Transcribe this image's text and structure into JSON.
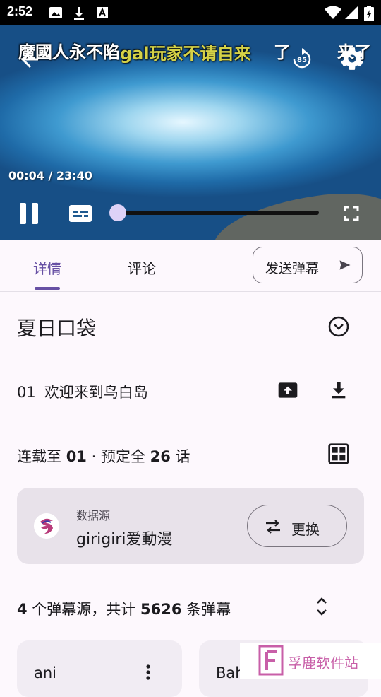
{
  "status_bar": {
    "time": "2:52",
    "icons": [
      "image-icon",
      "download-icon",
      "a-badge-icon",
      "wifi-icon",
      "signal-icon",
      "battery-icon"
    ]
  },
  "player": {
    "danmaku": [
      {
        "text": "魔國人永不陷",
        "color": "#ffffff"
      },
      {
        "text": "gal玩家不请自来",
        "color": "#d5d247"
      },
      {
        "text": "了",
        "color": "#ffffff"
      },
      {
        "text": "来了",
        "color": "#ffffff"
      }
    ],
    "replay_seconds": "85",
    "time_current": "00:04",
    "time_separator": " / ",
    "time_total": "23:40",
    "progress_fraction": 0.003
  },
  "tabs": {
    "details": "详情",
    "comments": "评论",
    "send_danmaku": "发送弹幕"
  },
  "anime": {
    "title": "夏日口袋",
    "episode_number": "01",
    "episode_title": "欢迎来到鸟白岛",
    "serial_prefix": "连载至 ",
    "serial_current": "01",
    "serial_middle": " · 预定全 ",
    "serial_total": "26",
    "serial_suffix": " 话"
  },
  "source": {
    "label": "数据源",
    "name": "girigiri爱動漫",
    "change_label": "更换"
  },
  "danmaku_info": {
    "source_count": "4",
    "text_a": " 个弹幕源，共计 ",
    "total": "5626",
    "text_b": " 条弹幕"
  },
  "danmaku_sources": [
    {
      "name": "ani"
    },
    {
      "name": "Bah"
    }
  ],
  "watermark": {
    "text": "孚鹿软件站"
  },
  "colors": {
    "accent": "#6750a4",
    "seek_thumb": "#ddd2f7",
    "card_bg": "#e8e2ea",
    "danmaku_yellow": "#d5d247"
  }
}
